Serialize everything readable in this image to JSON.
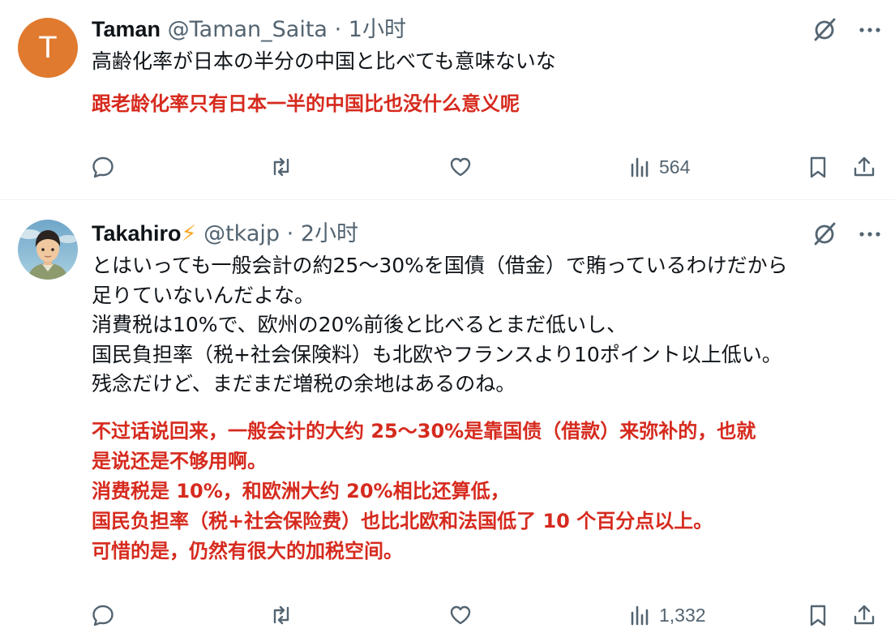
{
  "posts": [
    {
      "avatar_letter": "T",
      "avatar_color": "#e07a2e",
      "name": "Taman",
      "handle": "@Taman_Saita",
      "separator": "·",
      "time": "1小时",
      "text_original": "高齢化率が日本の半分の中国と比べても意味ないな",
      "text_translation": "跟老龄化率只有日本一半的中国比也没什么意义呢",
      "views": "564"
    },
    {
      "name": "Takahiro",
      "name_emoji": "⚡",
      "handle": "@tkajp",
      "separator": "·",
      "time": "2小时",
      "text_original": "とはいっても一般会計の約25〜30%を国債（借金）で賄っているわけだから\n足りていないんだよな。\n消費税は10%で、欧州の20%前後と比べるとまだ低いし、\n国民負担率（税+社会保険料）も北欧やフランスより10ポイント以上低い。\n残念だけど、まだまだ増税の余地はあるのね。",
      "text_translation": "不过话说回来，一般会计的大约 25〜30%是靠国债（借款）来弥补的，也就\n是说还是不够用啊。\n消费税是 10%，和欧洲大约 20%相比还算低，\n国民负担率（税+社会保险费）也比北欧和法国低了 10 个百分点以上。\n可惜的是，仍然有很大的加税空间。",
      "views": "1,332"
    }
  ],
  "icons": [
    "grok-icon",
    "more-icon",
    "reply-icon",
    "repost-icon",
    "like-icon",
    "views-icon",
    "bookmark-icon",
    "share-icon"
  ],
  "colors": {
    "text": "#0f1419",
    "secondary": "#536471",
    "translation": "#d62a1e",
    "divider": "#eff3f4"
  }
}
